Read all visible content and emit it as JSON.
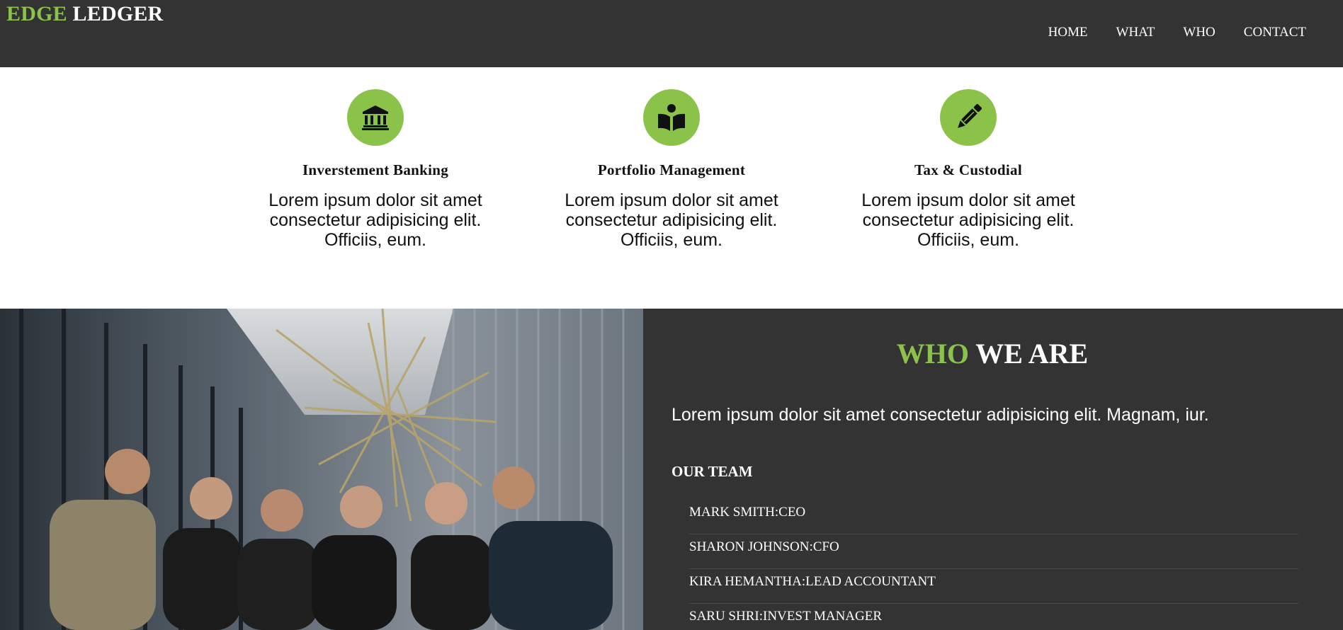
{
  "header": {
    "brand_accent": "EDGE",
    "brand_rest": "LEDGER",
    "nav": [
      "HOME",
      "WHAT",
      "WHO",
      "CONTACT"
    ]
  },
  "services": [
    {
      "icon": "bank-icon",
      "title": "Inverstement Banking",
      "text": "Lorem ipsum dolor sit amet consectetur adipisicing elit. Officiis, eum."
    },
    {
      "icon": "book-reader-icon",
      "title": "Portfolio Management",
      "text": "Lorem ipsum dolor sit amet consectetur adipisicing elit. Officiis, eum."
    },
    {
      "icon": "pencil-icon",
      "title": "Tax & Custodial",
      "text": "Lorem ipsum dolor sit amet consectetur adipisicing elit. Officiis, eum."
    }
  ],
  "who": {
    "title_accent": "WHO",
    "title_rest": "WE ARE",
    "description": "Lorem ipsum dolor sit amet consectetur adipisicing elit. Magnam, iur.",
    "team_heading": "OUR TEAM",
    "team": [
      "MARK SMITH:CEO",
      "SHARON JOHNSON:CFO",
      "KIRA HEMANTHA:LEAD ACCOUNTANT",
      "SARU SHRI:INVEST MANAGER"
    ]
  },
  "colors": {
    "accent": "#8bc34a",
    "dark": "#333333"
  }
}
